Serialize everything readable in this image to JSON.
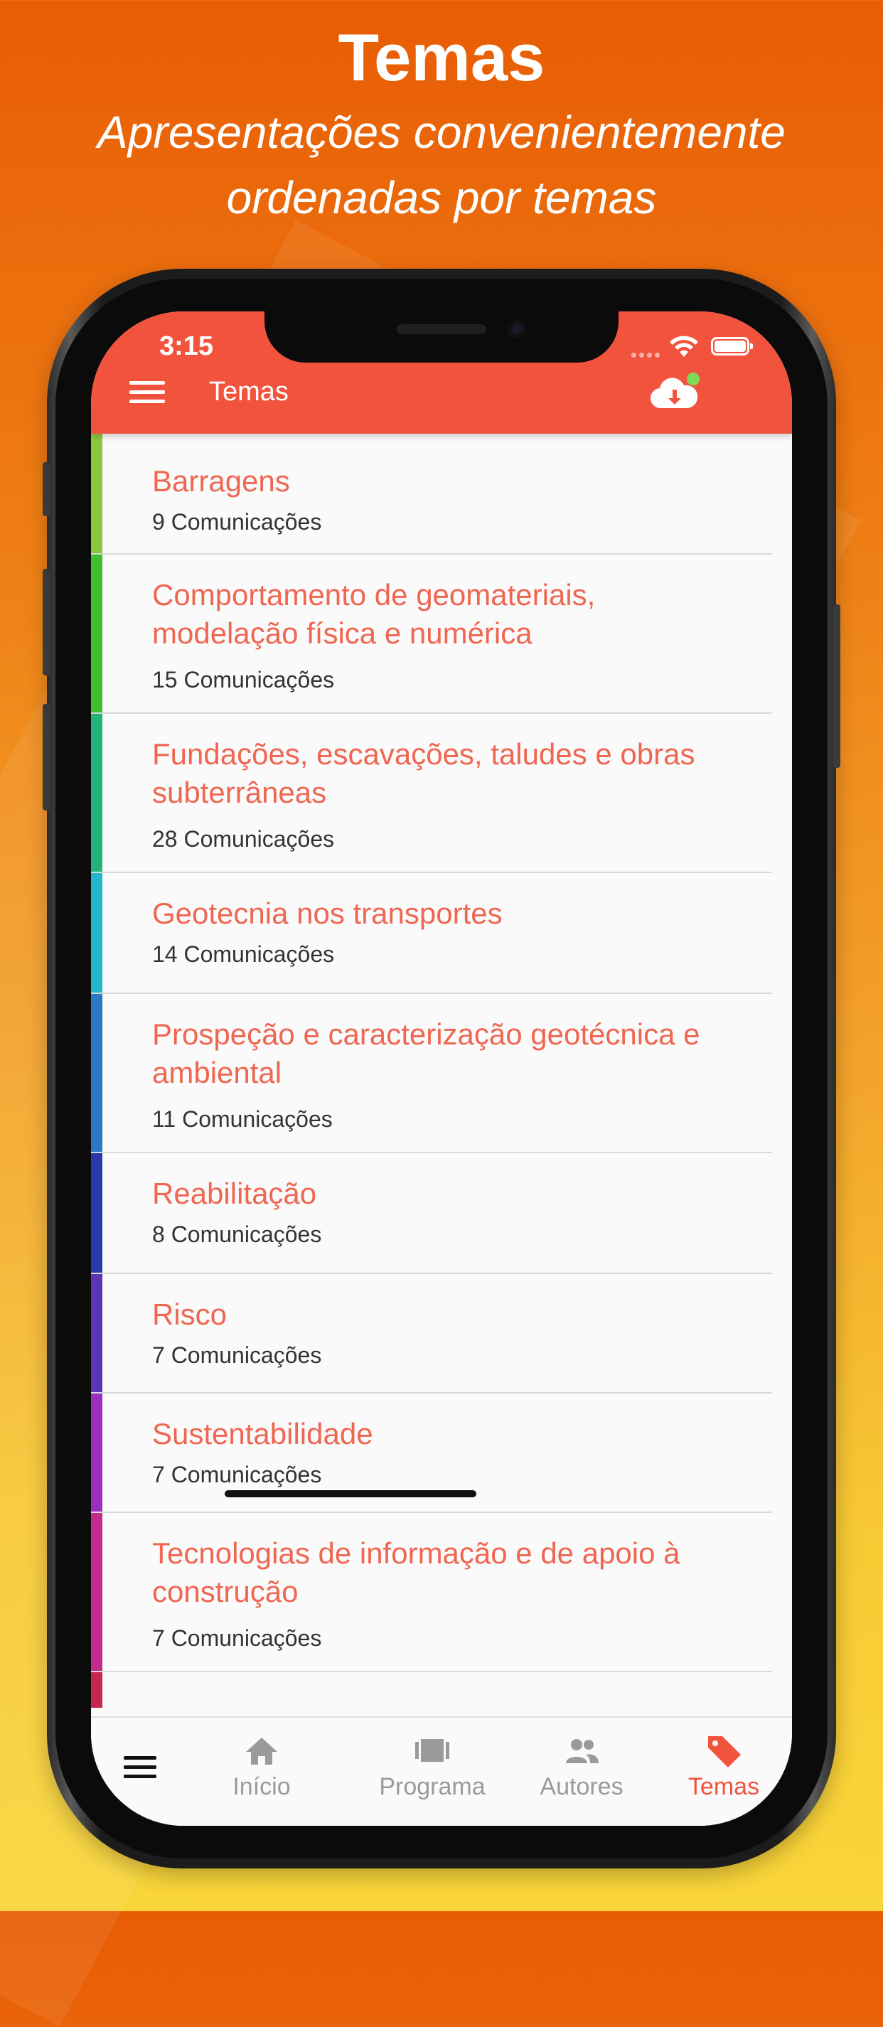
{
  "promo": {
    "headline": "Temas",
    "subheadline": "Apresentações convenientemente ordenadas por temas"
  },
  "status_bar": {
    "time": "3:15"
  },
  "header": {
    "title": "Temas",
    "menu_icon": "hamburger-menu-icon",
    "cloud_icon": "cloud-download-icon",
    "online_indicator_color": "#7ed957"
  },
  "theme": {
    "header_color": "#f2533c",
    "title_color": "#ef6651",
    "text_color": "#333333",
    "inactive_tab_color": "#9a9a9a"
  },
  "topics": [
    {
      "title": "Barragens",
      "count": "9 Comunicações",
      "color": "#8cc63f"
    },
    {
      "title": "Comportamento de geomateriais, modelação física e numérica",
      "count": "15 Comunicações",
      "color": "#3fbf2f"
    },
    {
      "title": "Fundações, escavações, taludes e obras subterrâneas",
      "count": "28 Comunicações",
      "color": "#22b37a"
    },
    {
      "title": "Geotecnia nos transportes",
      "count": "14 Comunicações",
      "color": "#21b6c9"
    },
    {
      "title": "Prospeção e caracterização geotécnica e ambiental",
      "count": "11 Comunicações",
      "color": "#2a79c4"
    },
    {
      "title": "Reabilitação",
      "count": "8 Comunicações",
      "color": "#2a38a8"
    },
    {
      "title": "Risco",
      "count": "7 Comunicações",
      "color": "#5b35b2"
    },
    {
      "title": "Sustentabilidade",
      "count": "7 Comunicações",
      "color": "#9a2fbf"
    },
    {
      "title": "Tecnologias de informação e de apoio à construção",
      "count": "7 Comunicações",
      "color": "#c32a8e"
    }
  ],
  "partial_topic_color": "#c8264f",
  "tab_bar": {
    "menu_icon": "hamburger-menu-icon",
    "tabs": [
      {
        "label": "Início",
        "icon": "home-icon",
        "active": false
      },
      {
        "label": "Programa",
        "icon": "schedule-icon",
        "active": false
      },
      {
        "label": "Autores",
        "icon": "people-icon",
        "active": false
      },
      {
        "label": "Temas",
        "icon": "tag-icon",
        "active": true
      }
    ]
  }
}
